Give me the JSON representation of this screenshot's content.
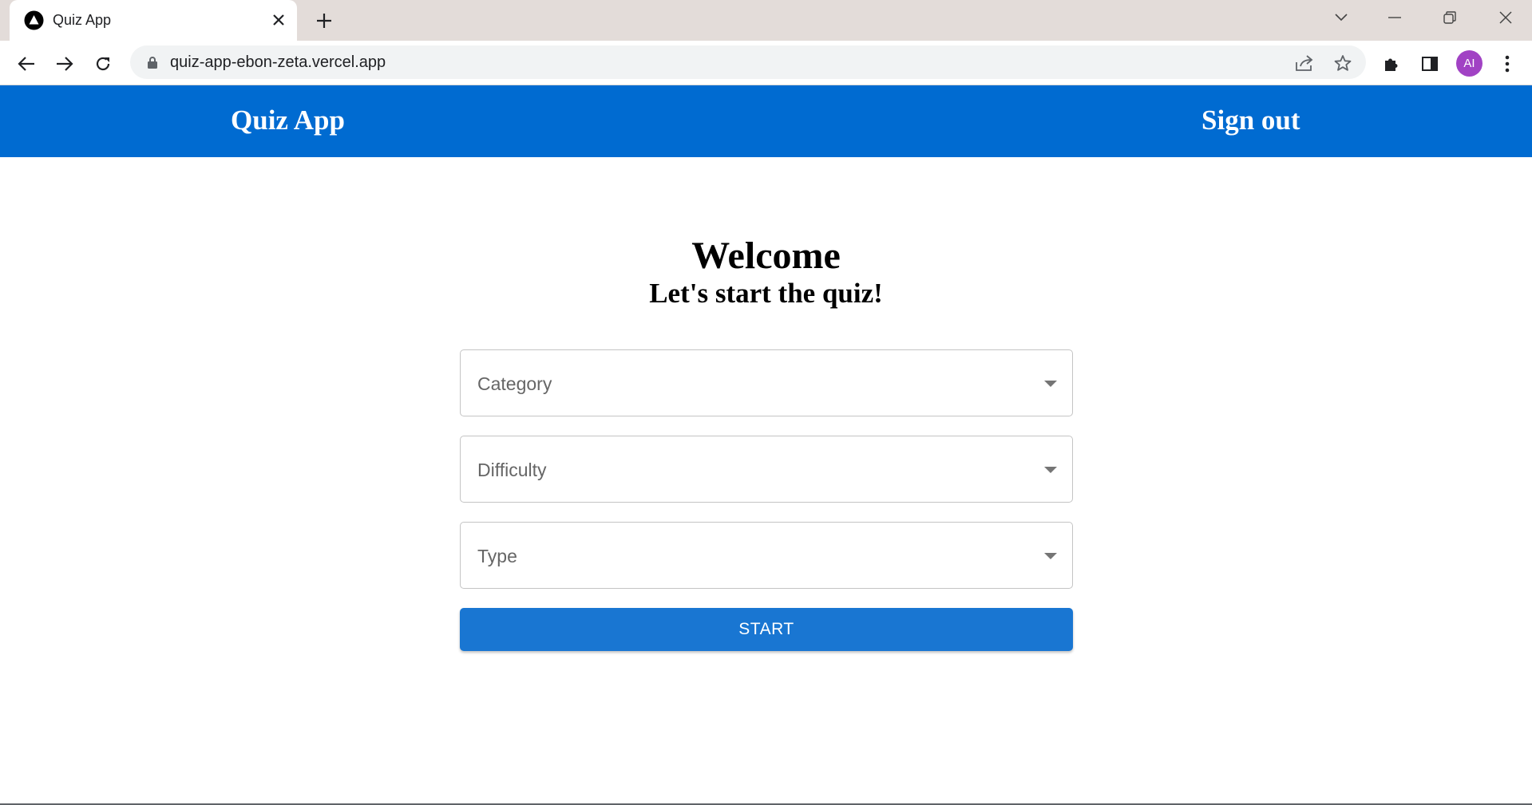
{
  "browser": {
    "tab": {
      "title": "Quiz App",
      "favicon": "triangle-logo-icon"
    },
    "url": "quiz-app-ebon-zeta.vercel.app",
    "profile_initials": "AI",
    "colors": {
      "tabstrip": "#e3dcd9",
      "avatar": "#a142c4"
    }
  },
  "header": {
    "brand": "Quiz App",
    "signout": "Sign out",
    "color": "#006bd1"
  },
  "main": {
    "title": "Welcome",
    "subtitle": "Let's start the quiz!",
    "selects": [
      {
        "label": "Category"
      },
      {
        "label": "Difficulty"
      },
      {
        "label": "Type"
      }
    ],
    "start_label": "START",
    "button_color": "#1976d2"
  }
}
